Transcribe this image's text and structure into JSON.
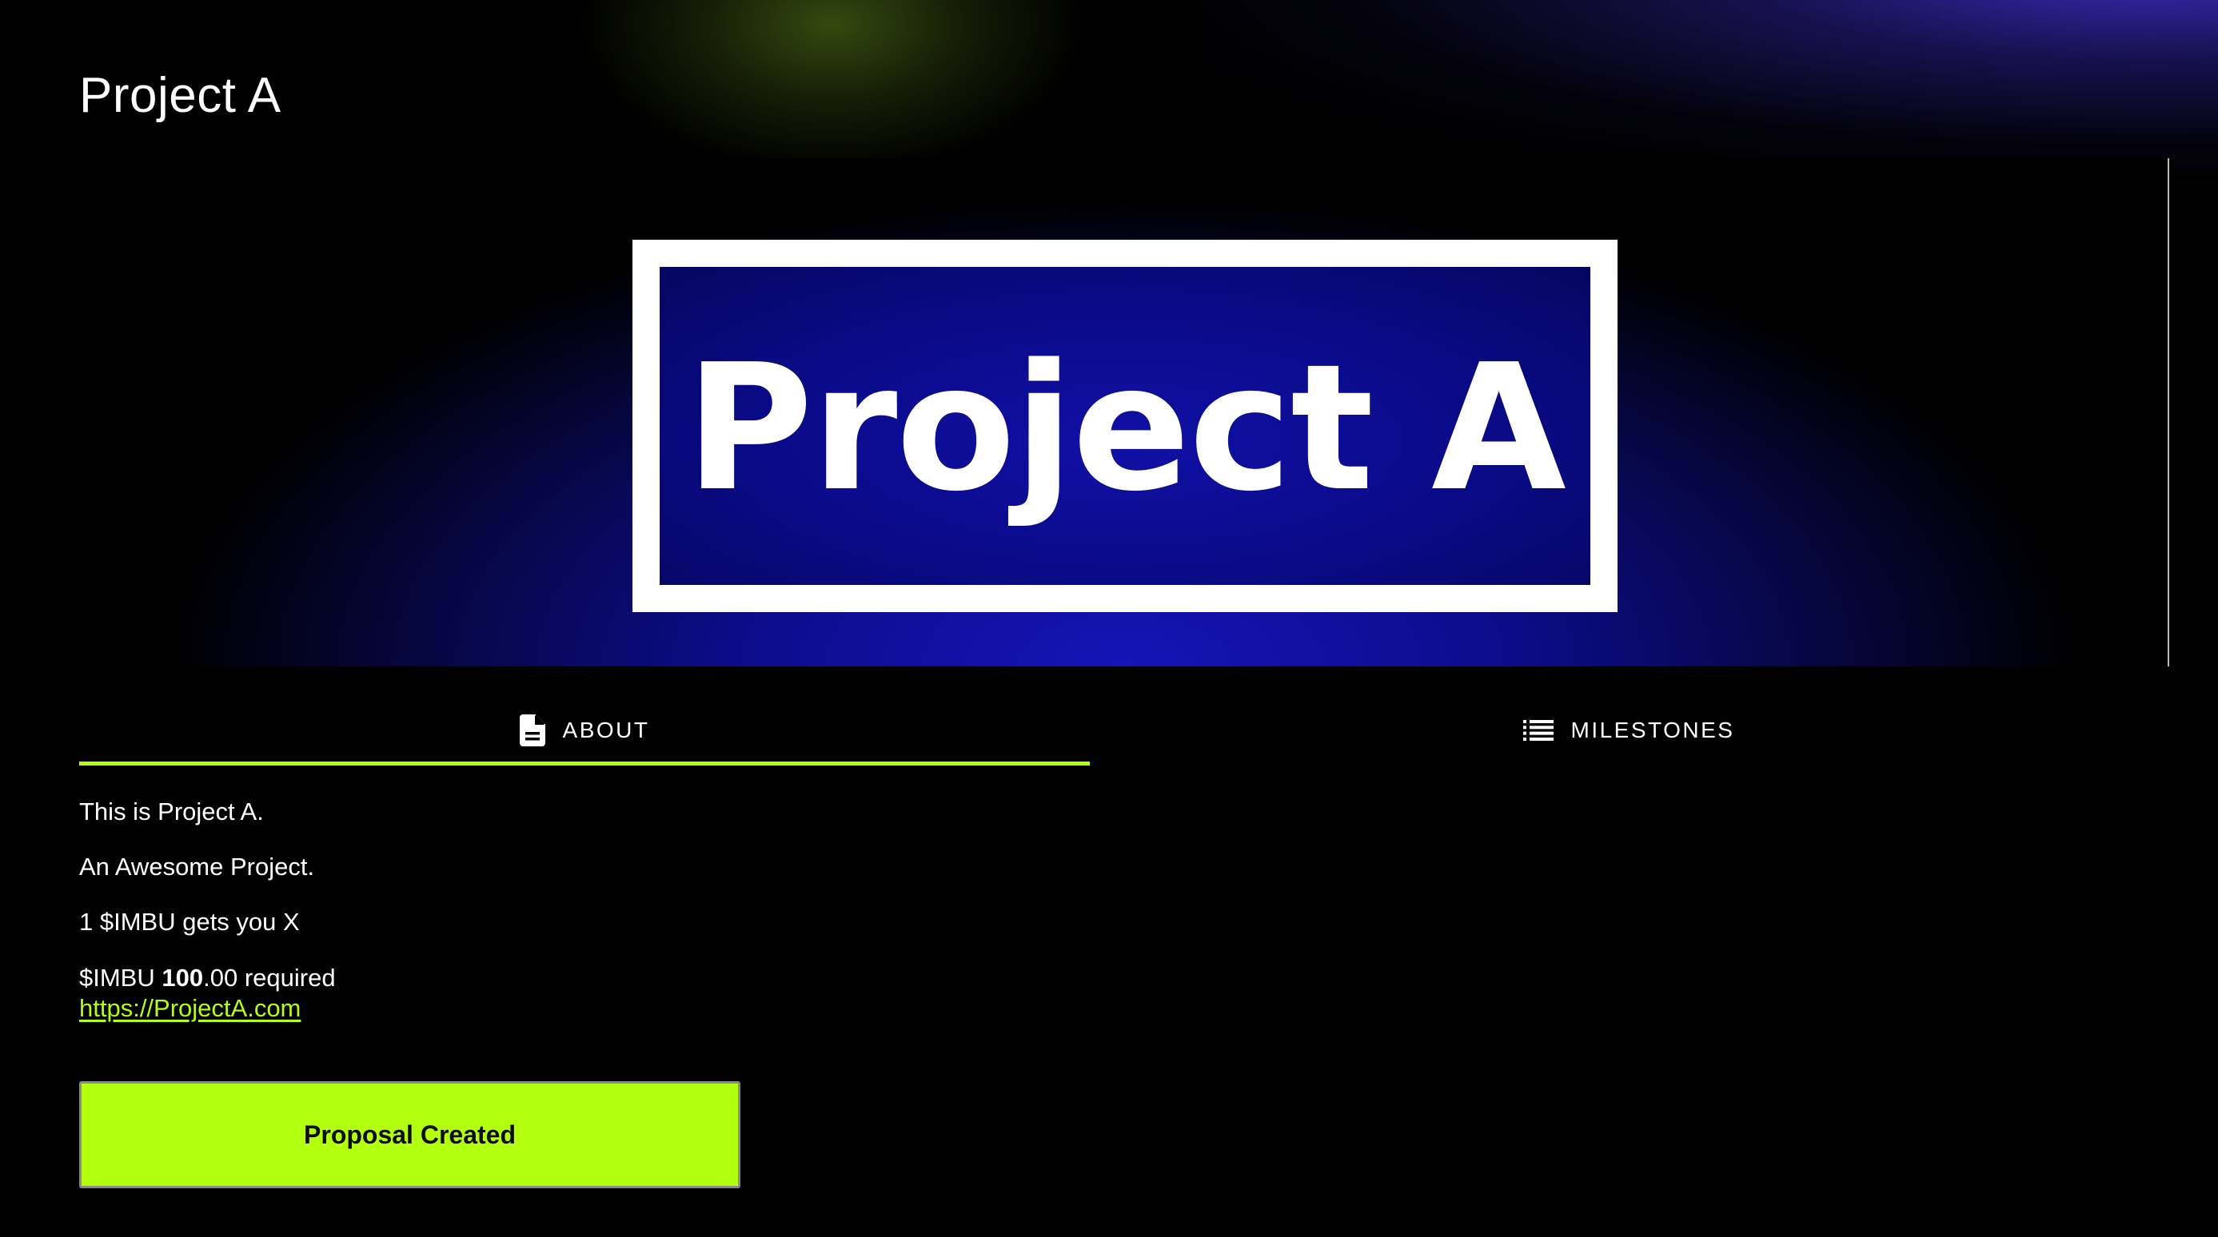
{
  "page": {
    "title": "Project A"
  },
  "banner": {
    "image_text": "Project A"
  },
  "tabs": [
    {
      "label": "ABOUT",
      "icon": "document-icon",
      "active": true
    },
    {
      "label": "MILESTONES",
      "icon": "list-icon",
      "active": false
    }
  ],
  "about": {
    "line1": "This is Project A.",
    "line2": "An Awesome Project.",
    "line3": "1 $IMBU gets you X",
    "currency": "$IMBU",
    "amount_whole": "100",
    "amount_decimal": ".00",
    "required_suffix": "required",
    "link": "https://ProjectA.com"
  },
  "action": {
    "button_label": "Proposal Created"
  },
  "colors": {
    "accent": "#b2ff10",
    "background": "#000000",
    "banner_blue": "#0c0c8c",
    "text": "#ffffff"
  }
}
